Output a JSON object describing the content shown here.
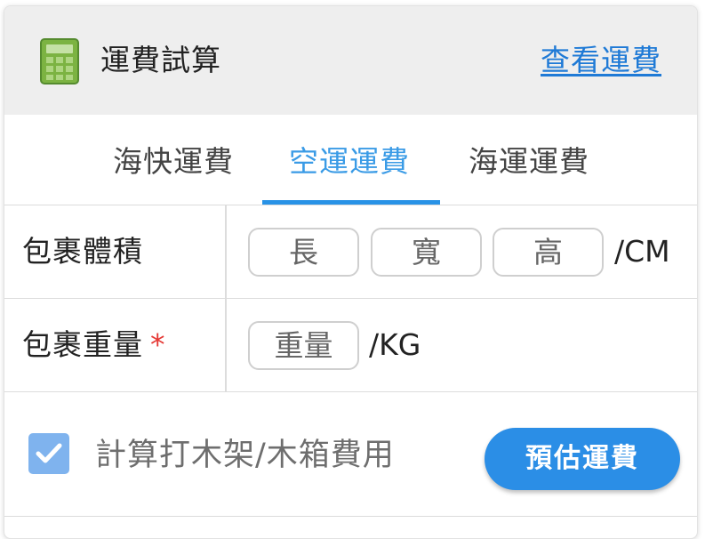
{
  "header": {
    "icon": "calculator-icon",
    "title": "運費試算",
    "link_label": "查看運費",
    "link_color": "#1f7ad6",
    "background": "#eeeeee"
  },
  "tabs": [
    {
      "label": "海快運費",
      "active": false
    },
    {
      "label": "空運運費",
      "active": true
    },
    {
      "label": "海運運費",
      "active": false
    }
  ],
  "active_tab_color": "#3a9be6",
  "form": {
    "volume": {
      "label": "包裹體積",
      "length_placeholder": "長",
      "width_placeholder": "寬",
      "height_placeholder": "高",
      "unit": "/CM"
    },
    "weight": {
      "label": "包裹重量",
      "required_mark": "*",
      "weight_placeholder": "重量",
      "unit": "/KG"
    }
  },
  "options": {
    "crate_checkbox_checked": true,
    "crate_checkbox_icon": "checkmark-icon",
    "crate_label": "計算打木架/木箱費用"
  },
  "actions": {
    "estimate_label": "預估運費",
    "estimate_color": "#2b8ee6"
  }
}
